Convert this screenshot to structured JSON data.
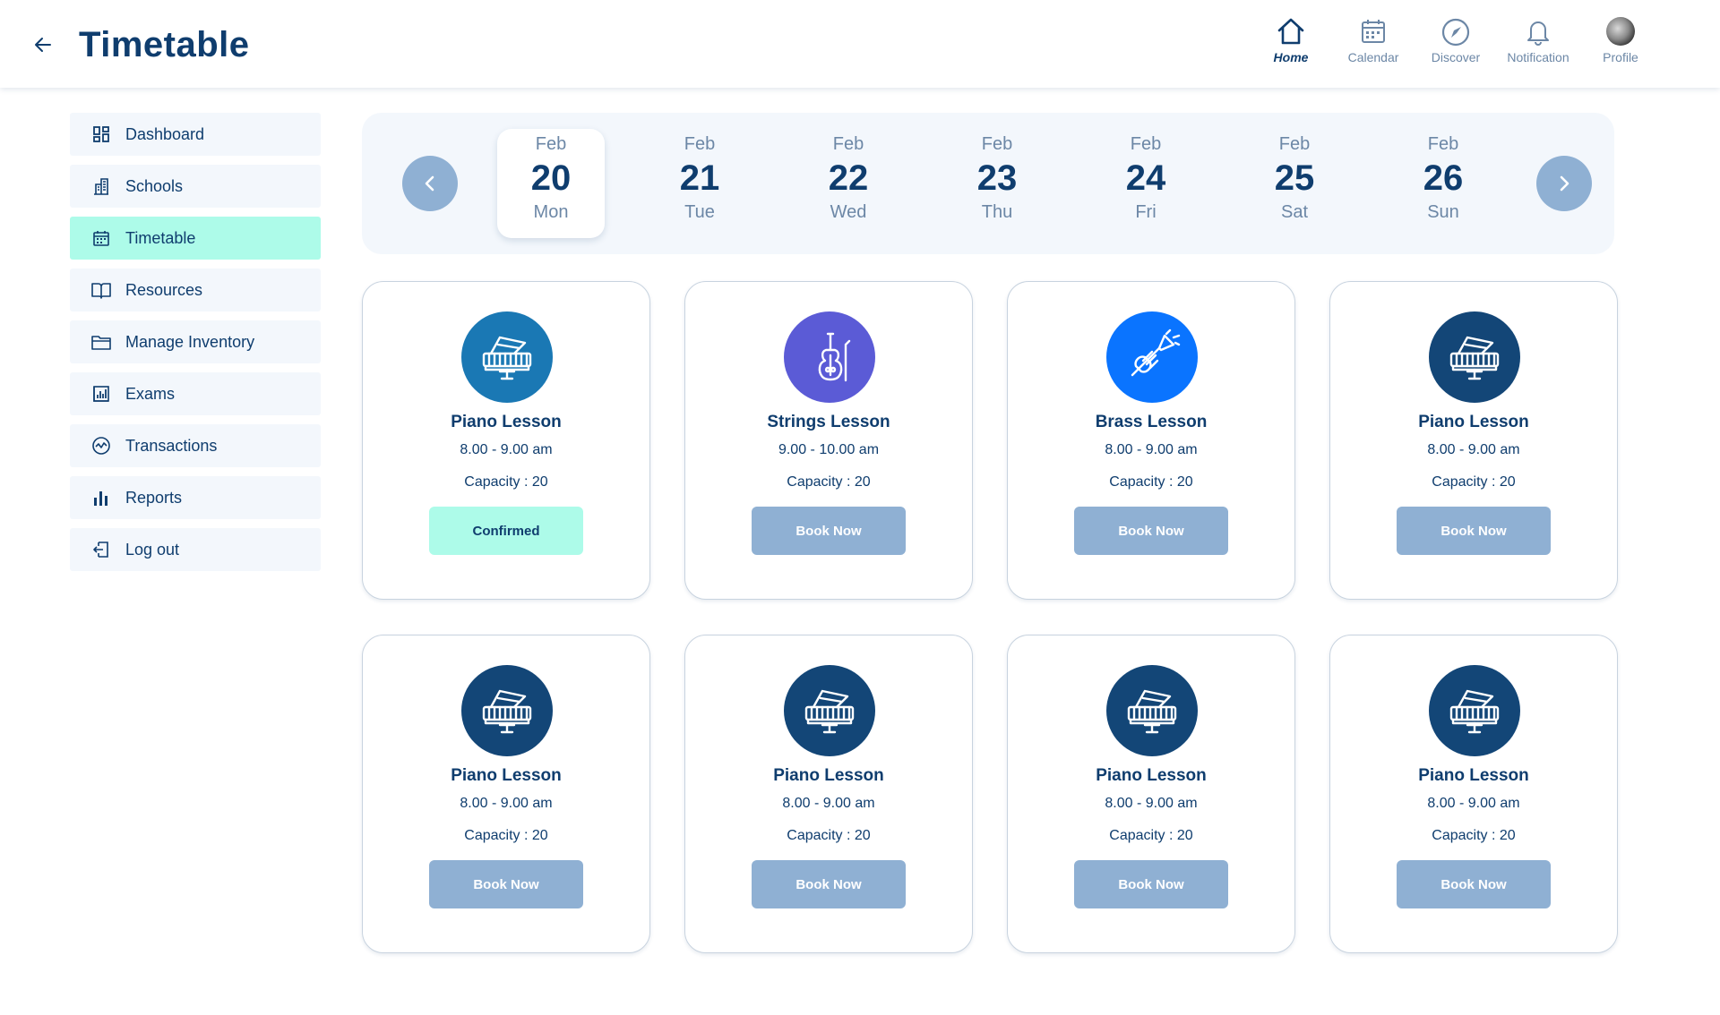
{
  "header": {
    "title": "Timetable",
    "back_icon": "arrow-left-icon",
    "nav": [
      {
        "label": "Home",
        "icon": "home-icon",
        "active": true
      },
      {
        "label": "Calendar",
        "icon": "calendar-icon",
        "active": false
      },
      {
        "label": "Discover",
        "icon": "compass-icon",
        "active": false
      },
      {
        "label": "Notification",
        "icon": "bell-icon",
        "active": false
      },
      {
        "label": "Profile",
        "icon": "avatar",
        "active": false
      }
    ]
  },
  "sidebar": {
    "items": [
      {
        "label": "Dashboard",
        "icon": "dashboard-icon",
        "active": false
      },
      {
        "label": "Schools",
        "icon": "building-icon",
        "active": false
      },
      {
        "label": "Timetable",
        "icon": "calendar-icon",
        "active": true
      },
      {
        "label": "Resources",
        "icon": "book-icon",
        "active": false
      },
      {
        "label": "Manage Inventory",
        "icon": "folder-icon",
        "active": false
      },
      {
        "label": "Exams",
        "icon": "exam-chart-icon",
        "active": false
      },
      {
        "label": "Transactions",
        "icon": "transactions-icon",
        "active": false
      },
      {
        "label": "Reports",
        "icon": "bar-chart-icon",
        "active": false
      },
      {
        "label": "Log out",
        "icon": "logout-icon",
        "active": false
      }
    ]
  },
  "dates": [
    {
      "month": "Feb",
      "day": "20",
      "weekday": "Mon",
      "selected": true
    },
    {
      "month": "Feb",
      "day": "21",
      "weekday": "Tue",
      "selected": false
    },
    {
      "month": "Feb",
      "day": "22",
      "weekday": "Wed",
      "selected": false
    },
    {
      "month": "Feb",
      "day": "23",
      "weekday": "Thu",
      "selected": false
    },
    {
      "month": "Feb",
      "day": "24",
      "weekday": "Fri",
      "selected": false
    },
    {
      "month": "Feb",
      "day": "25",
      "weekday": "Sat",
      "selected": false
    },
    {
      "month": "Feb",
      "day": "26",
      "weekday": "Sun",
      "selected": false
    }
  ],
  "lessons": [
    {
      "title": "Piano Lesson",
      "time": "8.00 - 9.00 am",
      "capacity": "Capacity : 20",
      "button": "Confirmed",
      "status": "confirmed",
      "icon": "piano-icon",
      "color": "#1a78b4"
    },
    {
      "title": "Strings Lesson",
      "time": "9.00 - 10.00 am",
      "capacity": "Capacity : 20",
      "button": "Book Now",
      "status": "book",
      "icon": "violin-icon",
      "color": "#5b5bd6"
    },
    {
      "title": "Brass Lesson",
      "time": "8.00 - 9.00 am",
      "capacity": "Capacity : 20",
      "button": "Book Now",
      "status": "book",
      "icon": "trumpet-icon",
      "color": "#0a74ff"
    },
    {
      "title": "Piano Lesson",
      "time": "8.00 - 9.00 am",
      "capacity": "Capacity : 20",
      "button": "Book Now",
      "status": "book",
      "icon": "piano-icon",
      "color": "#134677"
    },
    {
      "title": "Piano Lesson",
      "time": "8.00 - 9.00 am",
      "capacity": "Capacity : 20",
      "button": "Book Now",
      "status": "book",
      "icon": "piano-icon",
      "color": "#134677"
    },
    {
      "title": "Piano Lesson",
      "time": "8.00 - 9.00 am",
      "capacity": "Capacity : 20",
      "button": "Book Now",
      "status": "book",
      "icon": "piano-icon",
      "color": "#134677"
    },
    {
      "title": "Piano Lesson",
      "time": "8.00 - 9.00 am",
      "capacity": "Capacity : 20",
      "button": "Book Now",
      "status": "book",
      "icon": "piano-icon",
      "color": "#134677"
    },
    {
      "title": "Piano Lesson",
      "time": "8.00 - 9.00 am",
      "capacity": "Capacity : 20",
      "button": "Book Now",
      "status": "book",
      "icon": "piano-icon",
      "color": "#134677"
    }
  ],
  "colors": {
    "primary": "#0f3d6e",
    "accent_mint": "#adfbe9",
    "button_blue": "#8fb0d3",
    "muted_text": "#6c87a6",
    "panel_bg": "#f3f7fc"
  }
}
